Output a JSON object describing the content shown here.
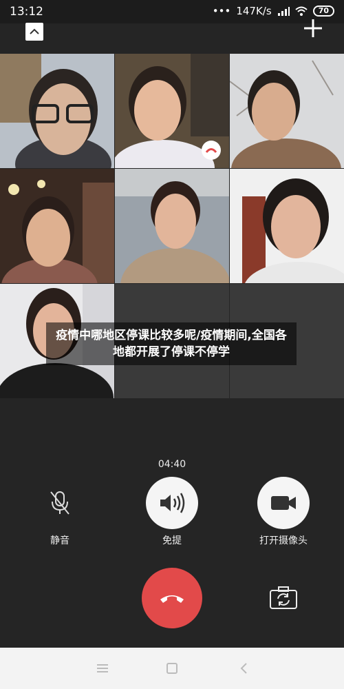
{
  "status": {
    "time": "13:12",
    "speed": "147K/s",
    "battery": "70"
  },
  "caption": "疫情中哪地区停课比较多呢/疫情期间,全国各地都开展了停课不停学",
  "call": {
    "timer": "04:40"
  },
  "controls": {
    "mute_label": "静音",
    "speaker_label": "免提",
    "camera_label": "打开摄像头"
  },
  "colors": {
    "hangup": "#e24a4a",
    "background": "#252525"
  },
  "icons": [
    "mic-off-icon",
    "speaker-icon",
    "camera-icon",
    "phone-hangup-icon",
    "switch-camera-icon",
    "collapse-icon",
    "add-icon"
  ]
}
